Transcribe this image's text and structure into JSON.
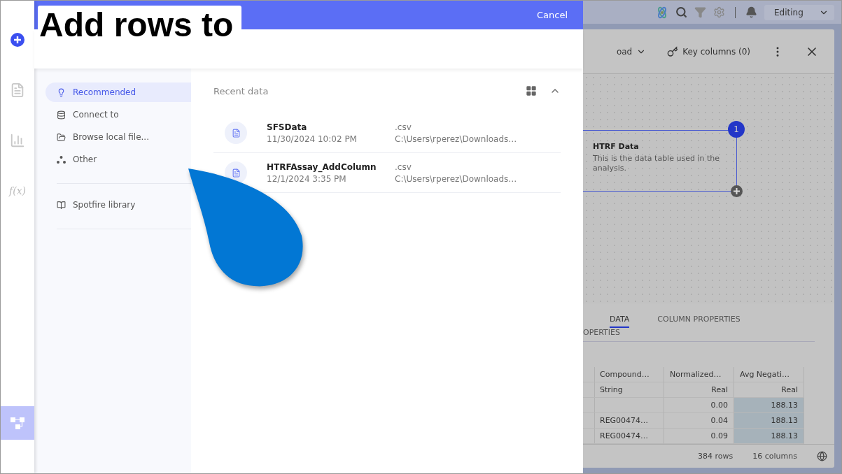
{
  "caption": "Add rows to",
  "rail": [
    {
      "kind": "add",
      "selected": false
    },
    {
      "kind": "table",
      "selected": false
    },
    {
      "kind": "chart",
      "selected": false
    },
    {
      "kind": "formula",
      "label": "f(x)",
      "selected": false
    },
    {
      "kind": "canvas",
      "selected": true
    }
  ],
  "dialog": {
    "cancel": "Cancel",
    "nav": [
      {
        "kind": "bulb",
        "label": "Recommended",
        "selected": true
      },
      {
        "kind": "database",
        "label": "Connect to",
        "selected": false
      },
      {
        "kind": "folder",
        "label": "Browse local file...",
        "selected": false
      },
      {
        "kind": "dots",
        "label": "Other",
        "selected": false
      }
    ],
    "library": {
      "kind": "book",
      "label": "Spotfire library",
      "selected": false
    },
    "recent": {
      "title": "Recent data",
      "items": [
        {
          "name": "SFSData",
          "date": "11/30/2024 10:02 PM",
          "type": ".csv",
          "path": "C:\\Users\\rperez\\Downloads…"
        },
        {
          "name": "HTRFAssay_AddColumn",
          "date": "12/1/2024 3:35 PM",
          "type": ".csv",
          "path": "C:\\Users\\rperez\\Downloads…"
        }
      ]
    }
  },
  "background": {
    "mode": "Editing",
    "load": "oad",
    "key_columns": "Key columns (0)",
    "node": {
      "badge": "1",
      "title": "HTRF Data",
      "description": "This is the data table used in the analysis."
    },
    "tabs": [
      {
        "label": "DATA",
        "selected": true
      },
      {
        "label": "COLUMN PROPERTIES",
        "selected": false
      }
    ],
    "tab_overflow": "OPERTIES",
    "table": {
      "columns": [
        {
          "name": "Compound…",
          "type": "String",
          "selected": false
        },
        {
          "name": "Normalized…",
          "type": "Real",
          "selected": false
        },
        {
          "name": "Avg Negati…",
          "type": "Real",
          "selected": true
        }
      ],
      "rows": [
        [
          "",
          "0.00",
          "188.13"
        ],
        [
          "REG00474…",
          "0.04",
          "188.13"
        ],
        [
          "REG00474…",
          "0.09",
          "188.13"
        ]
      ]
    },
    "footer": {
      "rows": "384 rows",
      "columns": "16 columns"
    }
  }
}
